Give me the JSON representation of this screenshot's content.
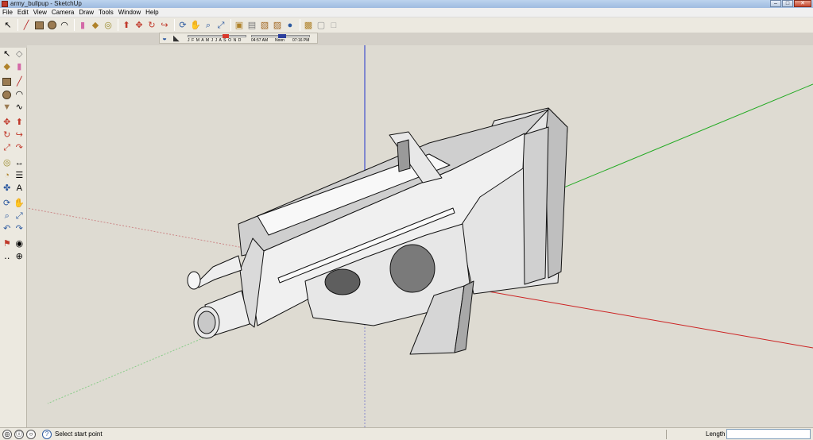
{
  "window": {
    "title": "army_bullpup - SketchUp",
    "controls": [
      "–",
      "□",
      "✕"
    ]
  },
  "menu": [
    "File",
    "Edit",
    "View",
    "Camera",
    "Draw",
    "Tools",
    "Window",
    "Help"
  ],
  "toolbar_icons": [
    "select-icon",
    "pencil-line-icon",
    "rectangle-icon",
    "circle-icon",
    "arc-icon",
    "eraser-icon",
    "paint-bucket-icon",
    "tape-measure-icon",
    "push-pull-icon",
    "move-icon",
    "rotate-icon",
    "follow-me-icon",
    "orbit-icon",
    "pan-icon",
    "zoom-icon",
    "zoom-extents-icon",
    "iso-view-icon",
    "top-view-icon",
    "front-view-icon",
    "right-view-icon",
    "back-view-icon",
    "left-view-icon",
    "xray-icon",
    "wireframe-icon"
  ],
  "shadows": {
    "months": "J F M A M J J A S O N D",
    "time_start": "04:57 AM",
    "time_mid": "Noon",
    "time_end": "07:16 PM"
  },
  "status": {
    "prompt": "Select start point",
    "vcb_label": "Length",
    "vcb_value": ""
  },
  "colors": {
    "x_axis": "#cc2222",
    "y_axis": "#22aa22",
    "z_axis": "#2233cc",
    "background": "#dedbd2"
  }
}
